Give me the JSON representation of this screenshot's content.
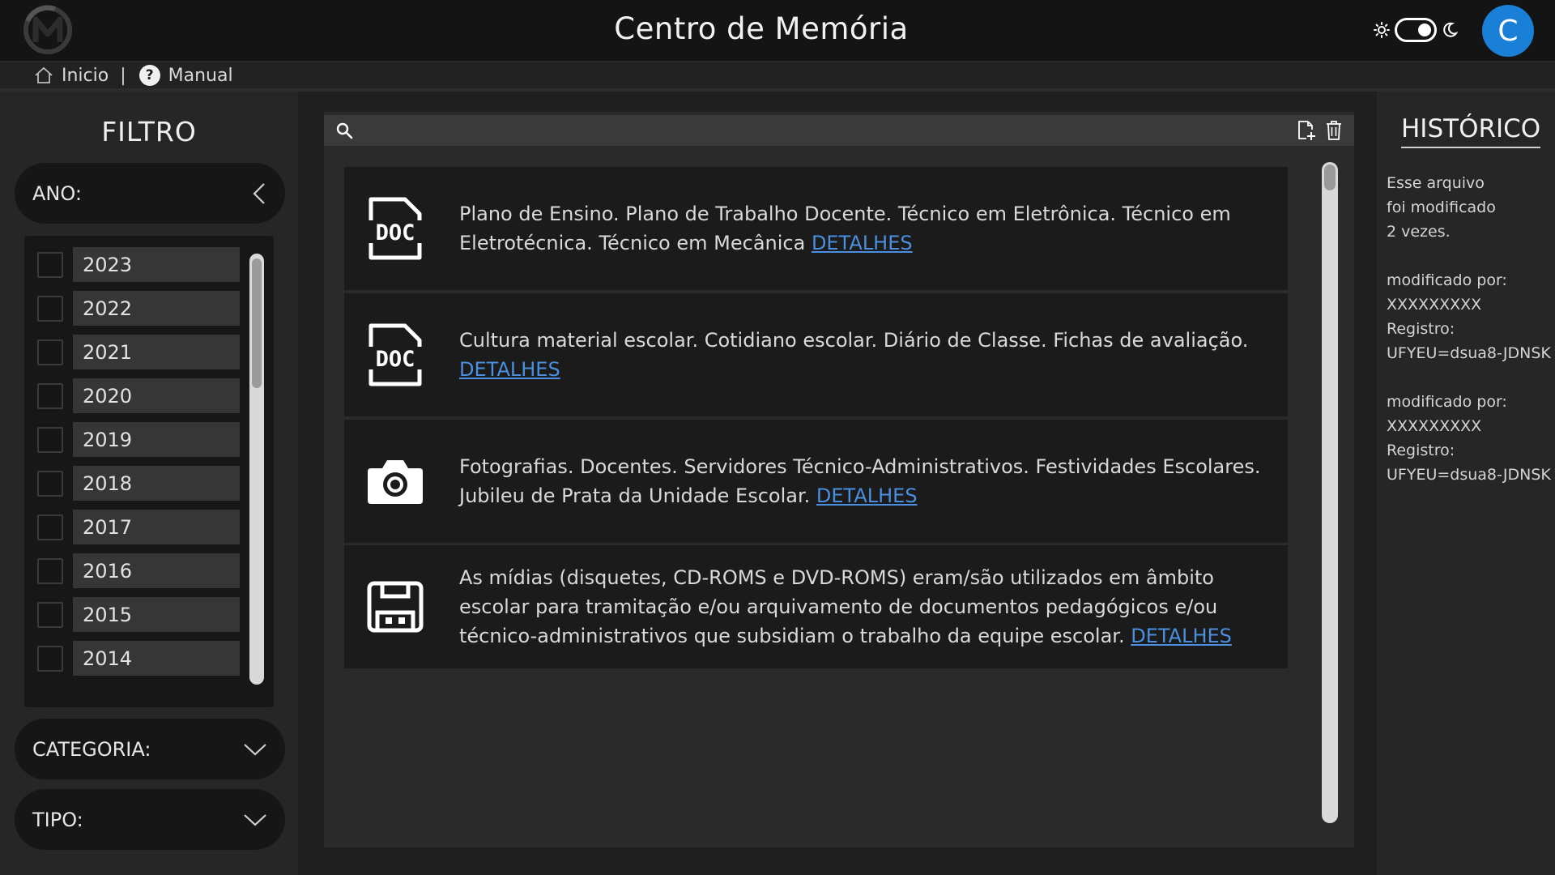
{
  "header": {
    "title": "Centro de Memória",
    "avatar_letter": "C",
    "colors": {
      "accent": "#1a7fd6",
      "link": "#4a8fe0"
    }
  },
  "breadcrumb": {
    "home_label": "Inicio",
    "separator": "|",
    "manual_label": "Manual",
    "manual_icon_glyph": "?"
  },
  "filter": {
    "title": "FILTRO",
    "ano_label": "ANO:",
    "categoria_label": "CATEGORIA:",
    "tipo_label": "TIPO:",
    "years": [
      "2023",
      "2022",
      "2021",
      "2020",
      "2019",
      "2018",
      "2017",
      "2016",
      "2015",
      "2014"
    ]
  },
  "search": {
    "placeholder": ""
  },
  "cards": [
    {
      "icon": "doc-icon",
      "text": "Plano de Ensino. Plano de Trabalho Docente. Técnico em Eletrônica. Técnico em Eletrotécnica. Técnico em Mecânica",
      "link": "DETALHES"
    },
    {
      "icon": "doc-icon",
      "text": "Cultura material escolar. Cotidiano escolar. Diário de Classe. Fichas de avaliação.",
      "link": "DETALHES"
    },
    {
      "icon": "camera-icon",
      "text": "Fotografias. Docentes. Servidores Técnico-Administrativos. Festividades Escolares. Jubileu de Prata da Unidade Escolar.",
      "link": "DETALHES"
    },
    {
      "icon": "floppy-disk-icon",
      "text": "As mídias (disquetes, CD-ROMS e DVD-ROMS) eram/são utilizados em âmbito escolar para tramitação e/ou arquivamento de documentos pedagógicos e/ou técnico-administrativos que subsidiam o trabalho da equipe escolar.",
      "link": "DETALHES"
    }
  ],
  "history": {
    "title": "HISTÓRICO",
    "intro": [
      "Esse arquivo",
      "foi modificado",
      "2 vezes."
    ],
    "entries": [
      {
        "modified_label": "modificado por:",
        "user": "XXXXXXXXX",
        "record_label": "Registro:",
        "record": "UFYEU=dsua8-JDNSK"
      },
      {
        "modified_label": "modificado por:",
        "user": "XXXXXXXXX",
        "record_label": "Registro:",
        "record": "UFYEU=dsua8-JDNSK"
      }
    ]
  }
}
